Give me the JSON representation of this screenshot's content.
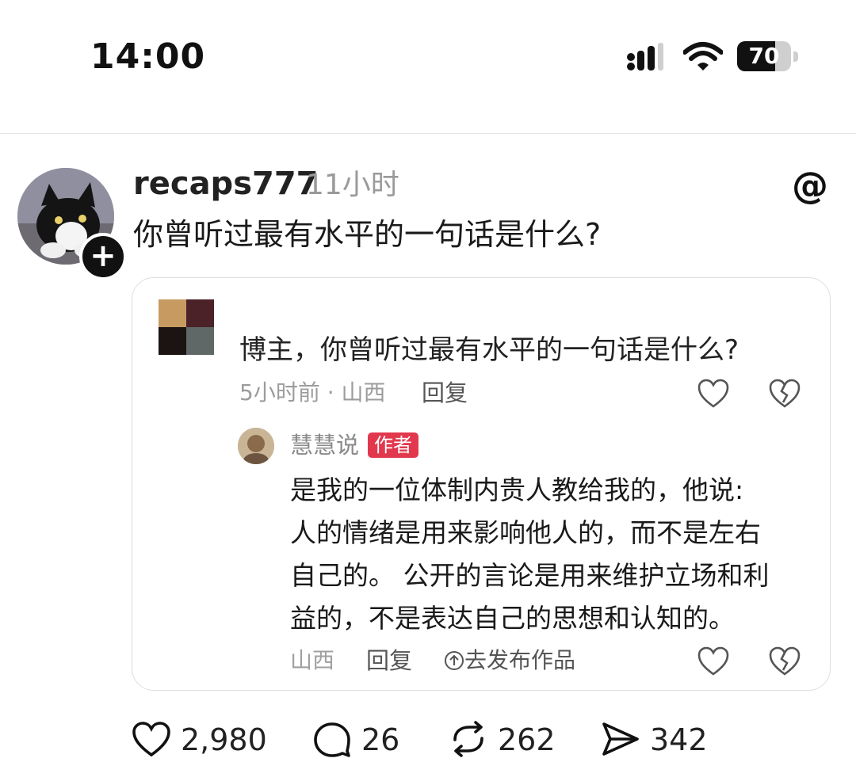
{
  "status_bar": {
    "time": "14:00",
    "battery_level": "70",
    "battery_fraction": 0.7
  },
  "post": {
    "username": "recaps777",
    "time_ago": "11小时",
    "question": "你曾听过最有水平的一句话是什么?",
    "follow_symbol": "+",
    "threads_logo_symbol": "@"
  },
  "embedded": {
    "comment": {
      "text": "博主，你曾听过最有水平的一句话是什么?",
      "meta": "5小时前 · 山西",
      "reply_label": "回复"
    },
    "reply": {
      "name": "慧慧说",
      "badge": "作者",
      "body_lines": [
        "是我的一位体制内贵人教给我的，他说:",
        "人的情绪是用来影响他人的，而不是左右",
        "自己的。 公开的言论是用来维护立场和利",
        "益的，不是表达自己的思想和认知的。"
      ],
      "location": "山西",
      "reply_label": "回复",
      "publish_label": "去发布作品"
    },
    "thumb_colors": [
      "#c79a62",
      "#4a2228",
      "#1c1412",
      "#5f6866"
    ]
  },
  "actions": {
    "likes": "2,980",
    "comments": "26",
    "reposts": "262",
    "shares": "342"
  },
  "icons": [
    "signal-icon",
    "wifi-icon",
    "battery-icon",
    "threads-logo-icon",
    "heart-icon",
    "broken-heart-icon",
    "comment-icon",
    "repost-icon",
    "share-icon",
    "upload-icon"
  ]
}
